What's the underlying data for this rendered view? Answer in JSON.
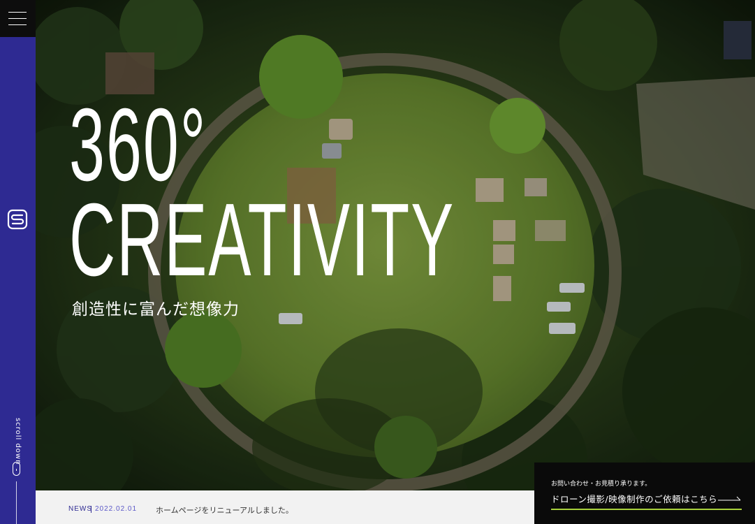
{
  "hero": {
    "title_line1": "360°",
    "title_line2": "CREATIVITY",
    "subtitle": "創造性に富んだ想像力"
  },
  "sidebar": {
    "menu_icon": "hamburger-icon",
    "logo_icon": "brand-s-logo",
    "scroll_label": "scroll down",
    "scroll_icon": "mouse-icon"
  },
  "news": {
    "label": "NEWS",
    "date": "2022.02.01",
    "text": "ホームページをリニューアルしました。"
  },
  "contact": {
    "small_text": "お問い合わせ・お見積り承ります。",
    "main_text": "ドローン撮影/映像制作のご依頼はこちら",
    "arrow_icon": "arrow-right-icon"
  },
  "colors": {
    "brand_blue": "#2e2a92",
    "accent_green": "#a8d13c",
    "dark": "#0a0a0a"
  }
}
